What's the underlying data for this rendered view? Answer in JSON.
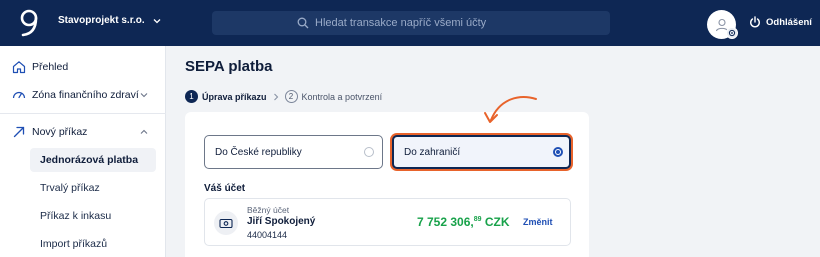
{
  "header": {
    "company": "Stavoprojekt s.r.o.",
    "search_placeholder": "Hledat transakce napříč všemi účty",
    "logout": "Odhlášení"
  },
  "sidebar": {
    "items": [
      {
        "label": "Přehled",
        "icon": "home-icon"
      },
      {
        "label": "Zóna finančního zdraví",
        "icon": "gauge-icon"
      },
      {
        "label": "Nový příkaz",
        "icon": "arrow-up-right-icon"
      }
    ],
    "sub_items": [
      {
        "label": "Jednorázová platba",
        "active": true
      },
      {
        "label": "Trvalý příkaz",
        "active": false
      },
      {
        "label": "Příkaz k inkasu",
        "active": false
      },
      {
        "label": "Import příkazů",
        "active": false
      }
    ]
  },
  "main": {
    "title": "SEPA platba",
    "steps": [
      {
        "num": "1",
        "label": "Úprava příkazu",
        "active": true
      },
      {
        "num": "2",
        "label": "Kontrola a potvrzení",
        "active": false
      }
    ],
    "options": [
      {
        "label": "Do České republiky",
        "selected": false
      },
      {
        "label": "Do zahraničí",
        "selected": true
      }
    ],
    "account_section": "Váš účet",
    "account": {
      "type": "Běžný účet",
      "name": "Jiří Spokojený",
      "number": "44004144",
      "balance_main": "7 752 306,",
      "balance_cents": "89",
      "currency": "CZK",
      "change": "Změnit"
    }
  },
  "colors": {
    "header_bg": "#0e2754",
    "accent": "#1f4fb4",
    "highlight": "#e8632b",
    "balance": "#18a24a"
  }
}
